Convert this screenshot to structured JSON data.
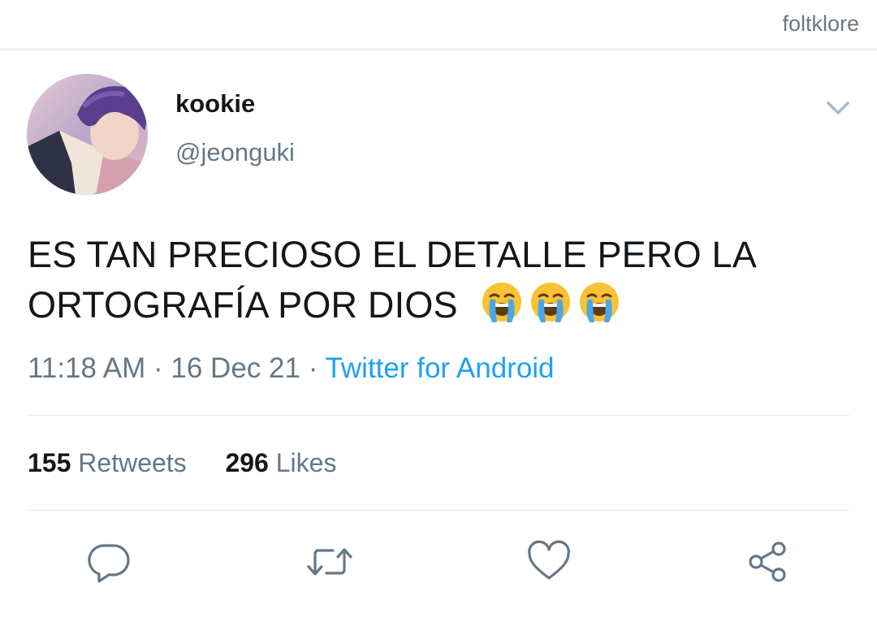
{
  "watermark": "foltklore",
  "tweet": {
    "author": {
      "display_name": "kookie",
      "handle": "@jeonguki"
    },
    "text_line1": "ES TAN PRECIOSO EL DETALLE PERO LA",
    "text_line2": "ORTOGRAFÍA POR DIOS",
    "emojis": [
      "loudly-crying-face",
      "loudly-crying-face",
      "loudly-crying-face"
    ],
    "time": "11:18 AM",
    "date": "16 Dec 21",
    "separator": "·",
    "source": "Twitter for Android",
    "stats": {
      "retweets_count": "155",
      "retweets_label": "Retweets",
      "likes_count": "296",
      "likes_label": "Likes"
    }
  },
  "actions": [
    "reply-icon",
    "retweet-icon",
    "like-icon",
    "share-icon"
  ],
  "colors": {
    "link": "#1da1f2",
    "secondary_text": "#657786",
    "primary_text": "#14171a",
    "icon": "#657786",
    "divider": "#e1e8ed"
  }
}
